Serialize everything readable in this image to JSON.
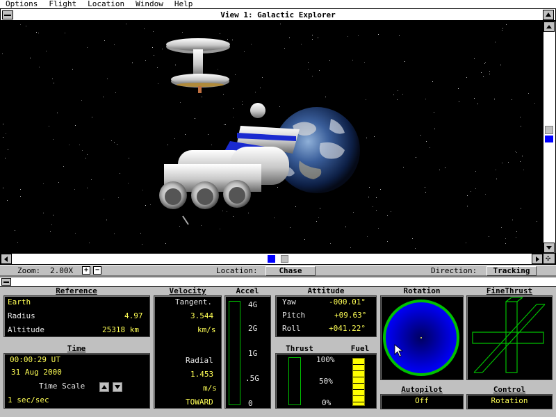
{
  "menu": [
    "Options",
    "Flight",
    "Location",
    "Window",
    "Help"
  ],
  "window": {
    "title": "View 1: Galactic Explorer"
  },
  "status": {
    "zoom_label": "Zoom:",
    "zoom_value": "2.00X",
    "zoom_plus": "+",
    "zoom_minus": "−",
    "location_label": "Location:",
    "location_value": "Chase",
    "direction_label": "Direction:",
    "direction_value": "Tracking"
  },
  "reference": {
    "title": "Reference",
    "body": "Earth",
    "radius_label": "Radius",
    "radius_value": "4.97",
    "altitude_label": "Altitude",
    "altitude_value": "25318 km"
  },
  "time": {
    "title": "Time",
    "clock": "00:00:29 UT",
    "date": "31 Aug 2000",
    "scale_label": "Time Scale",
    "scale_value": "1 sec/sec"
  },
  "velocity": {
    "title": "Velocity",
    "tangent_label": "Tangent.",
    "tangent_value": "3.544",
    "tangent_unit": "km/s",
    "radial_label": "Radial",
    "radial_value": "1.453",
    "radial_unit": "m/s",
    "radial_dir": "TOWARD"
  },
  "accel": {
    "title": "Accel",
    "ticks": [
      "4G",
      "2G",
      "1G",
      ".5G",
      "0"
    ]
  },
  "attitude": {
    "title": "Attitude",
    "yaw_label": "Yaw",
    "yaw_value": "-000.01°",
    "pitch_label": "Pitch",
    "pitch_value": "+09.63°",
    "roll_label": "Roll",
    "roll_value": "+041.22°"
  },
  "thrust": {
    "title": "Thrust",
    "ticks": [
      "100%",
      "50%",
      "0%"
    ]
  },
  "fuel": {
    "title": "Fuel",
    "level": 1.0
  },
  "rotation": {
    "title": "Rotation"
  },
  "finethrust": {
    "title": "FineThrust"
  },
  "autopilot": {
    "title": "Autopilot",
    "value": "Off"
  },
  "control": {
    "title": "Control",
    "value": "Rotation"
  },
  "colors": {
    "accent_yellow": "#ffff55",
    "dial_blue": "#0000ff",
    "dial_ring": "#00c000",
    "scroll_thumb": "#0000ff"
  }
}
